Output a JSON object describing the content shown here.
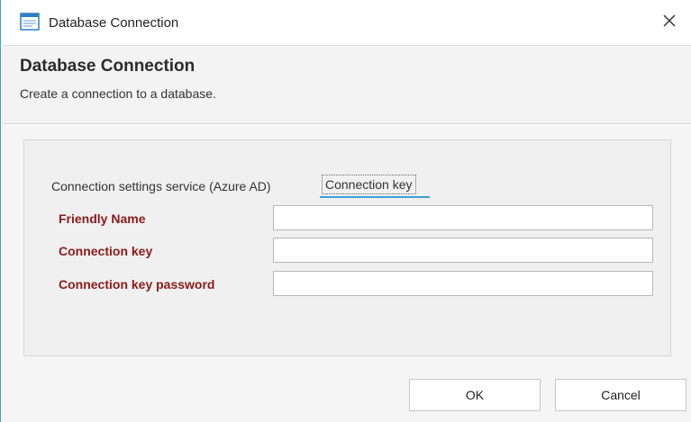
{
  "window": {
    "title": "Database Connection",
    "title_icon": "dialog-window-icon",
    "close_icon": "close-icon"
  },
  "header": {
    "title": "Database Connection",
    "subtitle": "Create a connection to a database."
  },
  "tabs": {
    "service_label": "Connection settings service (Azure AD)",
    "key_label": "Connection key"
  },
  "form": {
    "friendly_name_label": "Friendly Name",
    "friendly_name_value": "",
    "connection_key_label": "Connection key",
    "connection_key_value": "",
    "password_label": "Connection key password",
    "password_value": ""
  },
  "footer": {
    "ok_label": "OK",
    "cancel_label": "Cancel"
  },
  "colors": {
    "accent": "#3aa0d8",
    "required_label": "#8b1a1a"
  }
}
